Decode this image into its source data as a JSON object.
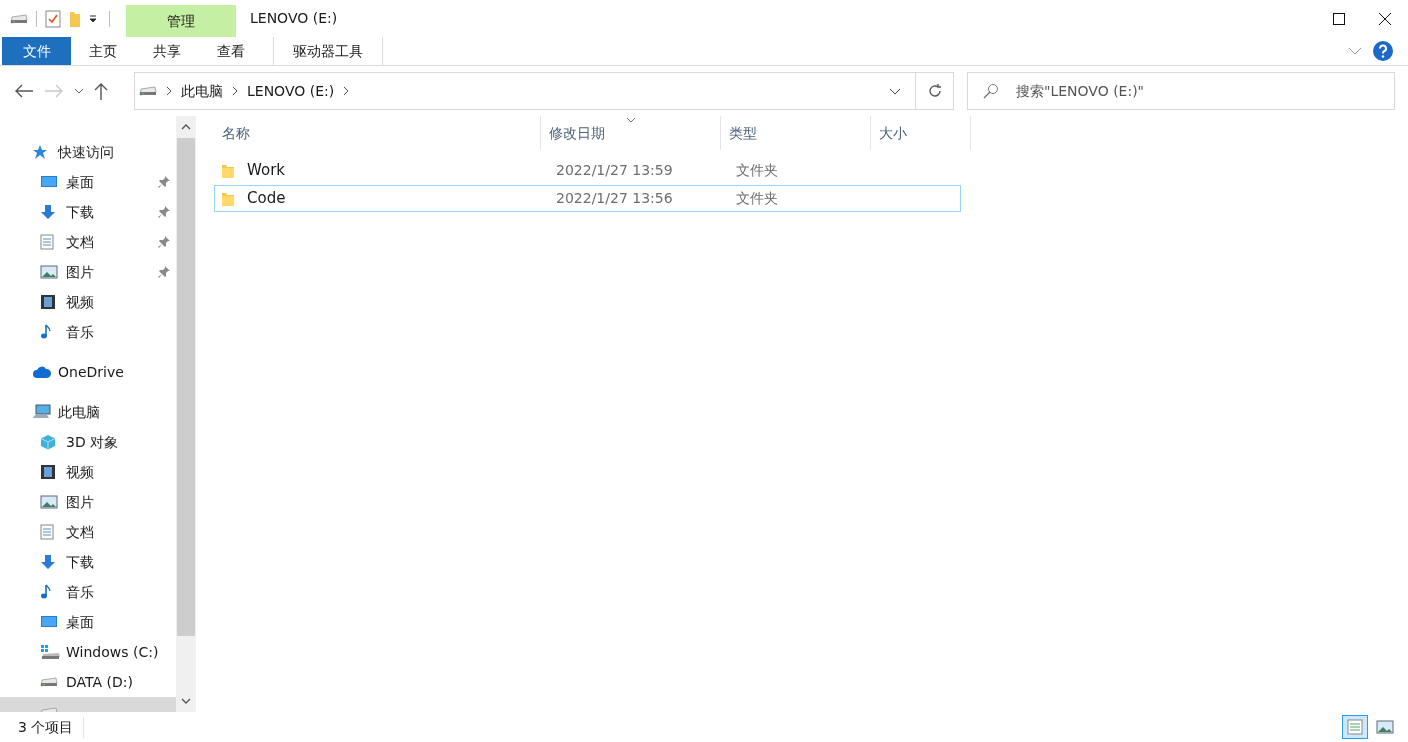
{
  "window": {
    "title": "LENOVO (E:)"
  },
  "quick_access_toolbar": [
    {
      "kind": "drive"
    },
    {
      "kind": "properties"
    },
    {
      "kind": "new-folder"
    },
    {
      "kind": "customize"
    }
  ],
  "context_tab": {
    "group": "管理",
    "tab": "驱动器工具"
  },
  "ribbon_tabs": [
    {
      "label": "文件",
      "kind": "file"
    },
    {
      "label": "主页",
      "kind": "tab"
    },
    {
      "label": "共享",
      "kind": "tab"
    },
    {
      "label": "查看",
      "kind": "tab"
    }
  ],
  "nav": {
    "back_disabled": false,
    "forward_disabled": true
  },
  "address": {
    "path": [
      "此电脑",
      "LENOVO (E:)"
    ]
  },
  "search": {
    "placeholder": "搜索\"LENOVO (E:)\""
  },
  "sidebar": {
    "groups": [
      {
        "label": "快速访问",
        "kind": "star",
        "selected": false,
        "children": [
          {
            "label": "桌面",
            "kind": "desktop",
            "pinned": true,
            "selected": false
          },
          {
            "label": "下载",
            "kind": "download",
            "pinned": true,
            "selected": false
          },
          {
            "label": "文档",
            "kind": "document",
            "pinned": true,
            "selected": false
          },
          {
            "label": "图片",
            "kind": "pictures",
            "pinned": true,
            "selected": false
          },
          {
            "label": "视频",
            "kind": "videos",
            "pinned": false,
            "selected": false
          },
          {
            "label": "音乐",
            "kind": "music",
            "pinned": false,
            "selected": false
          }
        ]
      },
      {
        "label": "OneDrive",
        "kind": "cloud",
        "selected": false
      },
      {
        "label": "此电脑",
        "kind": "pc",
        "selected": false,
        "children": [
          {
            "label": "3D 对象",
            "kind": "cube",
            "pinned": false,
            "selected": false
          },
          {
            "label": "视频",
            "kind": "videos",
            "pinned": false,
            "selected": false
          },
          {
            "label": "图片",
            "kind": "pictures",
            "pinned": false,
            "selected": false
          },
          {
            "label": "文档",
            "kind": "document",
            "pinned": false,
            "selected": false
          },
          {
            "label": "下载",
            "kind": "download",
            "pinned": false,
            "selected": false
          },
          {
            "label": "音乐",
            "kind": "music",
            "pinned": false,
            "selected": false
          },
          {
            "label": "桌面",
            "kind": "desktop",
            "pinned": false,
            "selected": false
          },
          {
            "label": "Windows (C:)",
            "kind": "windows-drive",
            "pinned": false,
            "selected": false
          },
          {
            "label": "DATA (D:)",
            "kind": "drive",
            "pinned": false,
            "selected": false
          },
          {
            "kind": "drive",
            "pinned": false,
            "selected": true
          }
        ]
      }
    ]
  },
  "columns": [
    {
      "label": "名称",
      "sorted": false
    },
    {
      "label": "修改日期",
      "sorted": true
    },
    {
      "label": "类型",
      "sorted": false
    },
    {
      "label": "大小",
      "sorted": false
    }
  ],
  "rows": [
    {
      "name": "Work",
      "modified": "2022/1/27 13:59",
      "type": "文件夹",
      "focused": false
    },
    {
      "name": "Code",
      "modified": "2022/1/27 13:56",
      "type": "文件夹",
      "focused": true
    }
  ],
  "status_bar": {
    "count": "3 个项目",
    "views": [
      {
        "kind": "details",
        "selected": true
      },
      {
        "kind": "large-icons",
        "selected": false
      }
    ]
  }
}
